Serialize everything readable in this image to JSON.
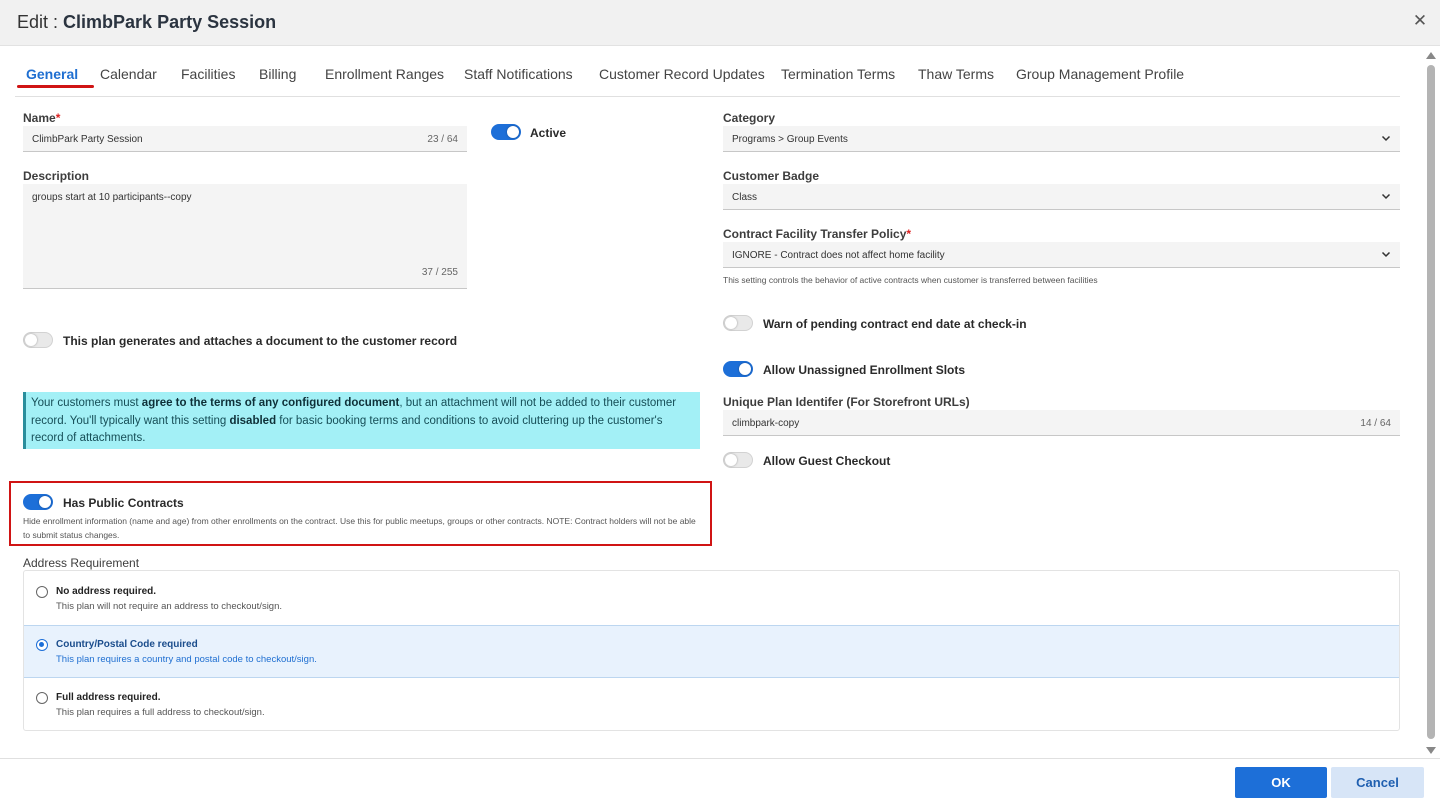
{
  "dialog": {
    "title_prefix": "Edit : ",
    "title_name": "ClimbPark Party Session",
    "close_glyph": "✕"
  },
  "tabs": [
    {
      "label": "General",
      "active": true
    },
    {
      "label": "Calendar"
    },
    {
      "label": "Facilities"
    },
    {
      "label": "Billing"
    },
    {
      "label": "Enrollment Ranges"
    },
    {
      "label": "Staff Notifications"
    },
    {
      "label": "Customer Record Updates"
    },
    {
      "label": "Termination Terms"
    },
    {
      "label": "Thaw Terms"
    },
    {
      "label": "Group Management Profile"
    }
  ],
  "form": {
    "name": {
      "label": "Name",
      "required_mark": "*",
      "value": "ClimbPark Party Session",
      "count": "23 / 64"
    },
    "active": {
      "label": "Active",
      "on": true
    },
    "description": {
      "label": "Description",
      "value": "groups start at 10 participants--copy",
      "count": "37 / 255"
    },
    "generates_document": {
      "label": "This plan generates and attaches a document to the customer record",
      "on": false
    },
    "info": {
      "part1": "Your customers must ",
      "bold1": "agree to the terms of any configured document",
      "part2": ", but an attachment will not be added to their customer record. You'll typically want this setting ",
      "bold2": "disabled",
      "part3": " for basic booking terms and conditions to avoid cluttering up the customer's record of attachments."
    },
    "public_contracts": {
      "label": "Has Public Contracts",
      "on": true,
      "hint": "Hide enrollment information (name and age) from other enrollments on the contract. Use this for public meetups, groups or other contracts. NOTE: Contract holders will not be able to submit status changes."
    },
    "category": {
      "label": "Category",
      "value": "Programs > Group Events"
    },
    "badge": {
      "label": "Customer Badge",
      "value": "Class"
    },
    "transfer_policy": {
      "label": "Contract Facility Transfer Policy",
      "required_mark": "*",
      "value": "IGNORE - Contract does not affect home facility",
      "hint": "This setting controls the behavior of active contracts when customer is transferred between facilities"
    },
    "warn_end_date": {
      "label": "Warn of pending contract end date at check-in",
      "on": false
    },
    "unassigned_slots": {
      "label": "Allow Unassigned Enrollment Slots",
      "on": true
    },
    "plan_identifier": {
      "label": "Unique Plan Identifer (For Storefront URLs)",
      "value": "climbpark-copy",
      "count": "14 / 64"
    },
    "guest_checkout": {
      "label": "Allow Guest Checkout",
      "on": false
    },
    "address": {
      "label": "Address Requirement",
      "options": [
        {
          "title": "No address required.",
          "sub": "This plan will not require an address to checkout/sign."
        },
        {
          "title": "Country/Postal Code required",
          "sub": "This plan requires a country and postal code to checkout/sign.",
          "selected": true
        },
        {
          "title": "Full address required.",
          "sub": "This plan requires a full address to checkout/sign."
        }
      ]
    }
  },
  "footer": {
    "ok": "OK",
    "cancel": "Cancel"
  },
  "colors": {
    "primary": "#1d6fd8",
    "highlight": "#d01414",
    "info_bg": "#a3f0f6"
  }
}
